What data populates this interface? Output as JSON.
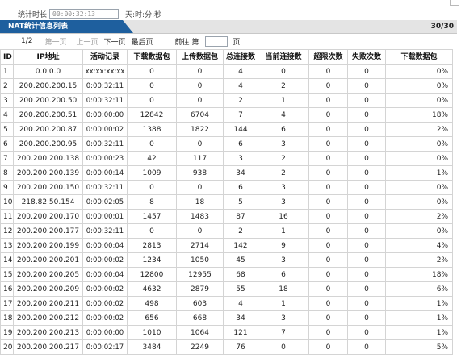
{
  "timer": {
    "label": "统计时长",
    "value": "00:00:32:13",
    "unit": "天:时:分:秒"
  },
  "header": {
    "title": "NAT统计信息列表",
    "count": "30/30"
  },
  "pager": {
    "page": "1/2",
    "first": "第一页",
    "prev": "上一页",
    "next": "下一页",
    "last": "最后页",
    "goto": "前往 第",
    "goto_value": "",
    "page_suffix": "页"
  },
  "table": {
    "columns": [
      "ID",
      "IP地址",
      "活动记录",
      "下载数据包",
      "上传数据包",
      "总连接数",
      "当前连接数",
      "超限次数",
      "失败次数",
      "下载数据包"
    ],
    "rows": [
      [
        "1",
        "0.0.0.0",
        "xx:xx:xx:xx",
        "0",
        "0",
        "4",
        "0",
        "0",
        "0",
        "0%"
      ],
      [
        "2",
        "200.200.200.15",
        "0:00:32:11",
        "0",
        "0",
        "4",
        "2",
        "0",
        "0",
        "0%"
      ],
      [
        "3",
        "200.200.200.50",
        "0:00:32:11",
        "0",
        "0",
        "2",
        "1",
        "0",
        "0",
        "0%"
      ],
      [
        "4",
        "200.200.200.51",
        "0:00:00:00",
        "12842",
        "6704",
        "7",
        "4",
        "0",
        "0",
        "18%"
      ],
      [
        "5",
        "200.200.200.87",
        "0:00:00:02",
        "1388",
        "1822",
        "144",
        "6",
        "0",
        "0",
        "2%"
      ],
      [
        "6",
        "200.200.200.95",
        "0:00:32:11",
        "0",
        "0",
        "6",
        "3",
        "0",
        "0",
        "0%"
      ],
      [
        "7",
        "200.200.200.138",
        "0:00:00:23",
        "42",
        "117",
        "3",
        "2",
        "0",
        "0",
        "0%"
      ],
      [
        "8",
        "200.200.200.139",
        "0:00:00:14",
        "1009",
        "938",
        "34",
        "2",
        "0",
        "0",
        "1%"
      ],
      [
        "9",
        "200.200.200.150",
        "0:00:32:11",
        "0",
        "0",
        "6",
        "3",
        "0",
        "0",
        "0%"
      ],
      [
        "10",
        "218.82.50.154",
        "0:00:02:05",
        "8",
        "18",
        "5",
        "3",
        "0",
        "0",
        "0%"
      ],
      [
        "11",
        "200.200.200.170",
        "0:00:00:01",
        "1457",
        "1483",
        "87",
        "16",
        "0",
        "0",
        "2%"
      ],
      [
        "12",
        "200.200.200.177",
        "0:00:32:11",
        "0",
        "0",
        "2",
        "1",
        "0",
        "0",
        "0%"
      ],
      [
        "13",
        "200.200.200.199",
        "0:00:00:04",
        "2813",
        "2714",
        "142",
        "9",
        "0",
        "0",
        "4%"
      ],
      [
        "14",
        "200.200.200.201",
        "0:00:00:02",
        "1234",
        "1050",
        "45",
        "3",
        "0",
        "0",
        "2%"
      ],
      [
        "15",
        "200.200.200.205",
        "0:00:00:04",
        "12800",
        "12955",
        "68",
        "6",
        "0",
        "0",
        "18%"
      ],
      [
        "16",
        "200.200.200.209",
        "0:00:00:02",
        "4632",
        "2879",
        "55",
        "18",
        "0",
        "0",
        "6%"
      ],
      [
        "17",
        "200.200.200.211",
        "0:00:00:02",
        "498",
        "603",
        "4",
        "1",
        "0",
        "0",
        "1%"
      ],
      [
        "18",
        "200.200.200.212",
        "0:00:00:02",
        "656",
        "668",
        "34",
        "3",
        "0",
        "0",
        "1%"
      ],
      [
        "19",
        "200.200.200.213",
        "0:00:00:00",
        "1010",
        "1064",
        "121",
        "7",
        "0",
        "0",
        "1%"
      ],
      [
        "20",
        "200.200.200.217",
        "0:00:02:17",
        "3484",
        "2249",
        "76",
        "0",
        "0",
        "0",
        "5%"
      ]
    ]
  },
  "colors": {
    "header_tab": "#1e5f9e",
    "header_bar": "#e4e4e4",
    "grid": "#d4d4d4"
  }
}
